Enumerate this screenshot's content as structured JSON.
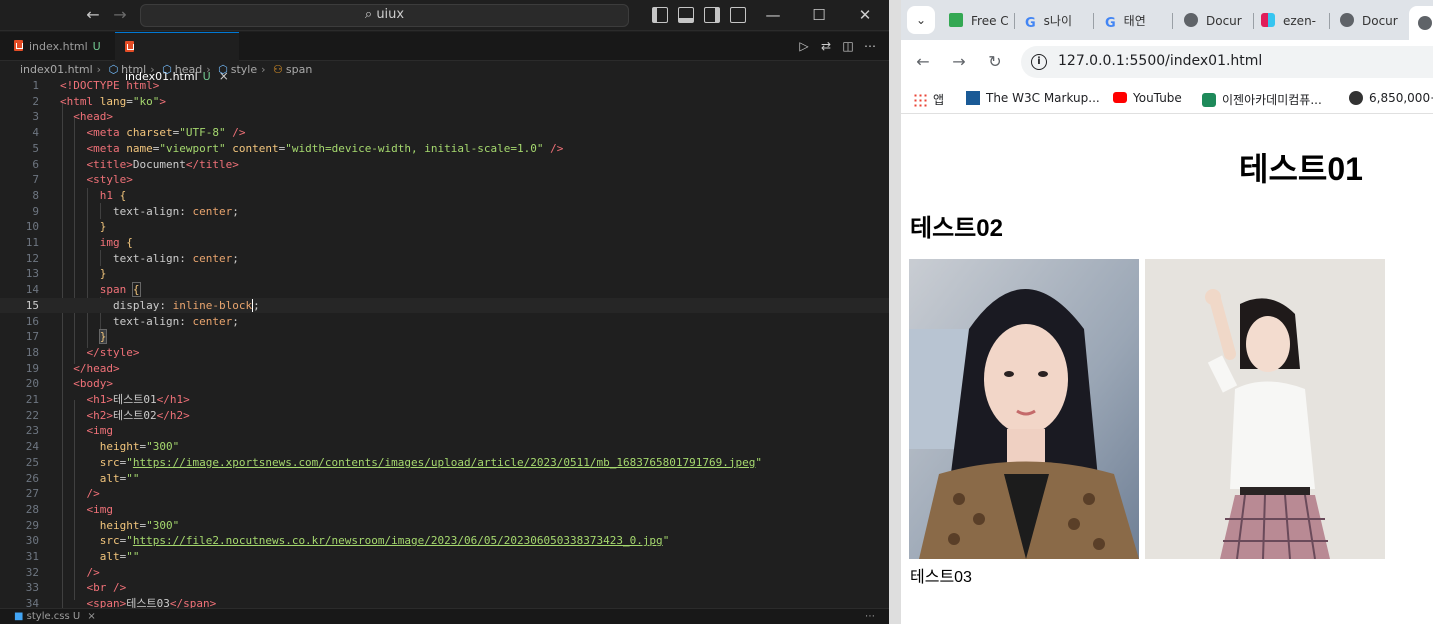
{
  "vscode": {
    "search_text": "uiux",
    "tabs": [
      {
        "label": "index.html",
        "status": "U"
      },
      {
        "label": "index01.html",
        "status": "U",
        "close": "×"
      }
    ],
    "breadcrumb": [
      "index01.html",
      "html",
      "head",
      "style",
      "span"
    ],
    "bottom_tab": "style.css  U",
    "current_line": 15,
    "code_lines": [
      "1",
      "2",
      "3",
      "4",
      "5",
      "6",
      "7",
      "8",
      "9",
      "10",
      "11",
      "12",
      "13",
      "14",
      "15",
      "16",
      "17",
      "18",
      "19",
      "20",
      "21",
      "22",
      "23",
      "24",
      "25",
      "26",
      "27",
      "28",
      "29",
      "30",
      "31",
      "32",
      "33"
    ],
    "code": {
      "l1": "<!DOCTYPE html>",
      "l2_lang": "\"ko\"",
      "l4_charset": "\"UTF-8\"",
      "l5_name": "\"viewport\"",
      "l5_content": "\"width=device-width, initial-scale=1.0\"",
      "l6_title": "Document",
      "sel_h1": "h1",
      "sel_img": "img",
      "sel_span": "span",
      "prop_align": "text-align",
      "val_center": "center",
      "prop_display": "display",
      "val_inline": "inline-block",
      "h1_text": "테스트01",
      "h2_text": "테스트02",
      "height_val": "\"300\"",
      "src1": "https://image.xportsnews.com/contents/images/upload/article/2023/0511/mb_1683765801791769.jpeg",
      "src2": "https://file2.nocutnews.co.kr/newsroom/image/2023/06/05/202306050338373423_0.jpg",
      "alt_val": "\"\"",
      "span_text": "테스트03"
    }
  },
  "chrome": {
    "tabs": [
      {
        "label": "Free C",
        "color": "#34a853"
      },
      {
        "label": "s나이",
        "color": "#4285f4"
      },
      {
        "label": "태연",
        "color": "#4285f4"
      },
      {
        "label": "Docur",
        "color": "#5f6368"
      },
      {
        "label": "ezen-",
        "color": "#e01e5a"
      },
      {
        "label": "Docur",
        "color": "#5f6368"
      }
    ],
    "url": "127.0.0.1:5500/index01.html",
    "bookmarks": [
      {
        "label": "앱"
      },
      {
        "label": "The W3C Markup..."
      },
      {
        "label": "YouTube"
      },
      {
        "label": "이젠아카데미컴퓨..."
      },
      {
        "label": "6,850,000+"
      }
    ],
    "page": {
      "h1": "테스트01",
      "h2": "테스트02",
      "span": "테스트03"
    }
  }
}
